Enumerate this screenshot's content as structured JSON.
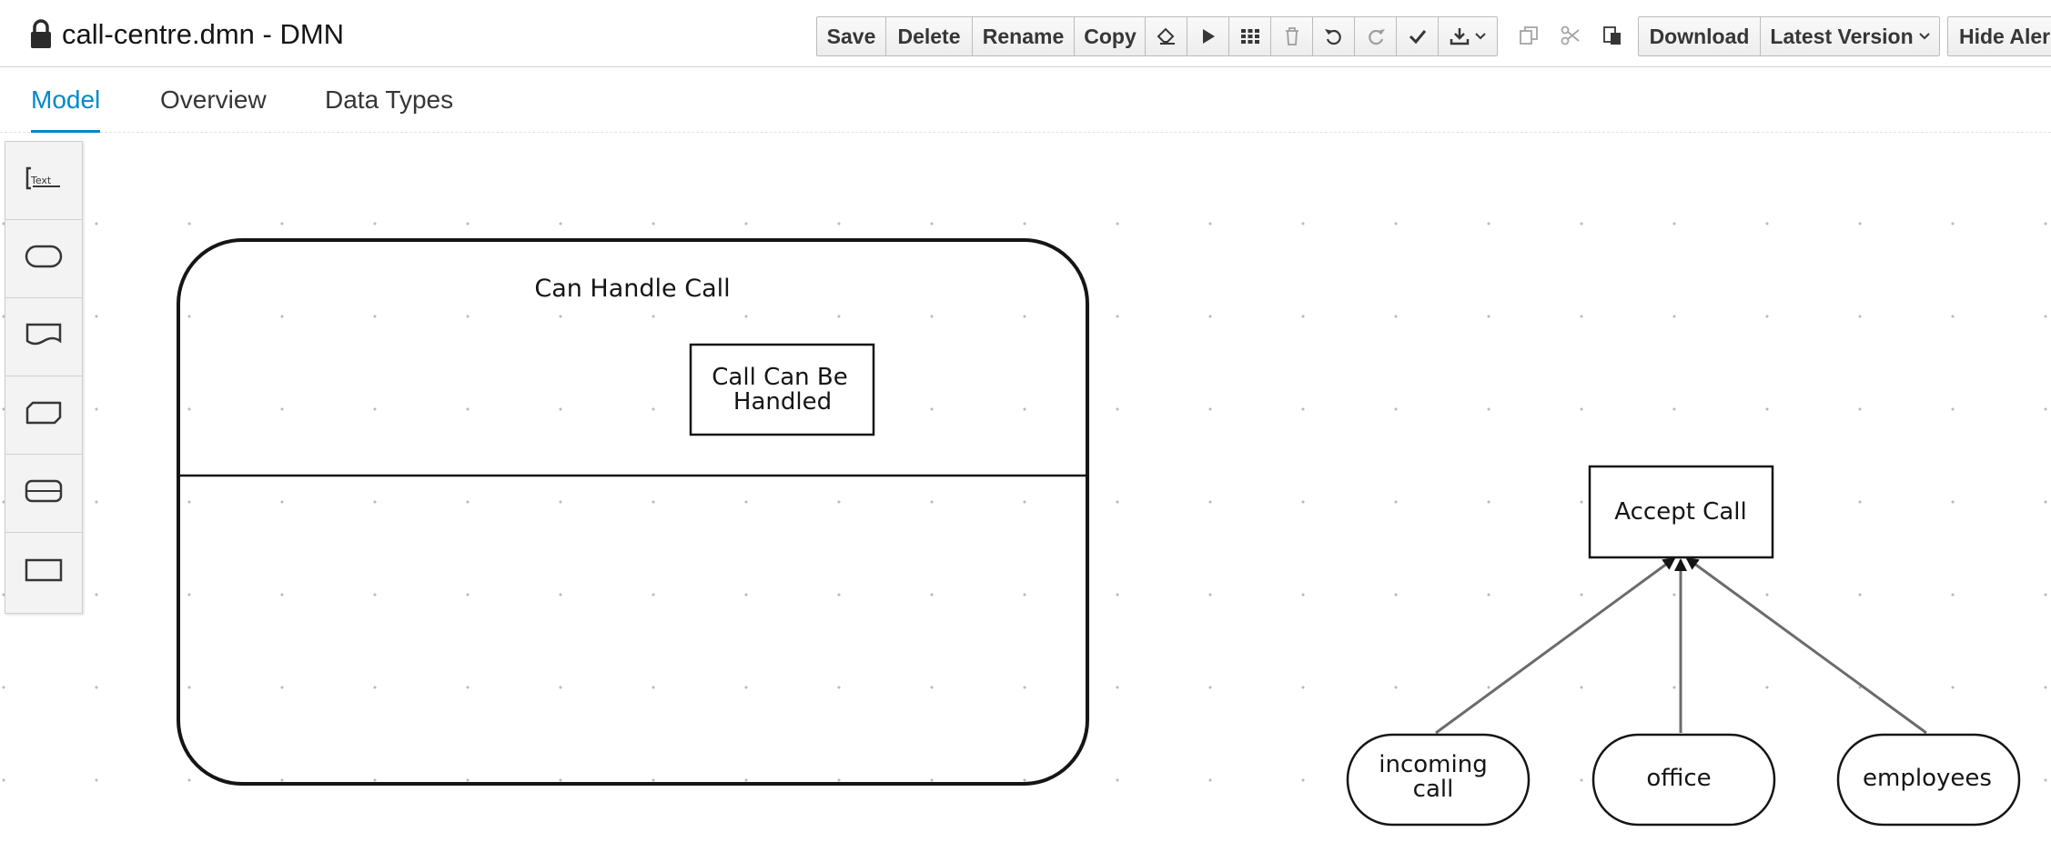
{
  "header": {
    "title": "call-centre.dmn - DMN",
    "lock_icon": "lock-icon"
  },
  "toolbar": {
    "save": "Save",
    "delete": "Delete",
    "rename": "Rename",
    "copy": "Copy",
    "download": "Download",
    "latest_version": "Latest Version",
    "hide_alerts": "Hide Aler"
  },
  "tabs": [
    {
      "label": "Model",
      "active": true
    },
    {
      "label": "Overview",
      "active": false
    },
    {
      "label": "Data Types",
      "active": false
    }
  ],
  "diagram": {
    "decision_service": {
      "name": "Can Handle Call"
    },
    "decision_inner": {
      "line1": "Call Can Be",
      "line2": "Handled"
    },
    "decision_accept": {
      "name": "Accept Call"
    },
    "inputs": [
      {
        "line1": "incoming",
        "line2": "call"
      },
      {
        "line1": "office",
        "line2": ""
      },
      {
        "line1": "employees",
        "line2": ""
      }
    ]
  },
  "palette": {
    "items": [
      "text-annotation-tool",
      "input-data-tool",
      "knowledge-source-tool",
      "business-knowledge-model-tool",
      "decision-service-tool",
      "decision-tool"
    ]
  },
  "colors": {
    "accent": "#0088ce",
    "node_stroke": "#151515",
    "edge_stroke": "#6b6b6b"
  }
}
